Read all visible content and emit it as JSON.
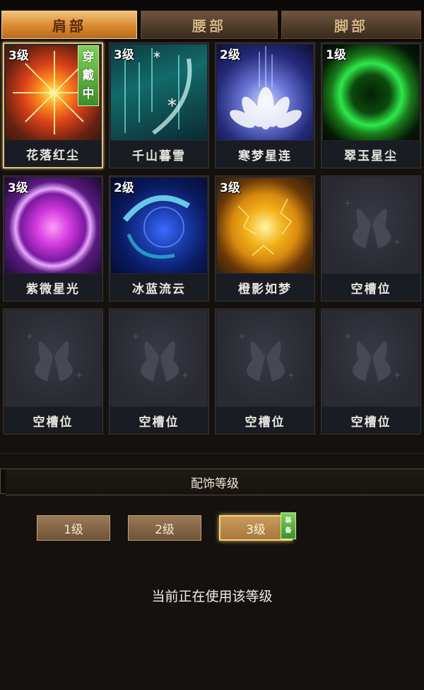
{
  "tabs": [
    {
      "label": "肩部",
      "active": true
    },
    {
      "label": "腰部",
      "active": false
    },
    {
      "label": "脚部",
      "active": false
    }
  ],
  "slots": [
    {
      "level": "3级",
      "name": "花落红尘",
      "icon": "red-sun-burst-icon",
      "color": "#e8701f",
      "worn": true,
      "selected": true
    },
    {
      "level": "3级",
      "name": "千山暮雪",
      "icon": "teal-snow-streaks-icon",
      "color": "#2aa8a0"
    },
    {
      "level": "2级",
      "name": "寒梦星连",
      "icon": "white-lotus-icon",
      "color": "#6a7ae8"
    },
    {
      "level": "1级",
      "name": "翠玉星尘",
      "icon": "green-orb-icon",
      "color": "#2ee84a"
    },
    {
      "level": "3级",
      "name": "紫微星光",
      "icon": "purple-orb-icon",
      "color": "#d23ae0"
    },
    {
      "level": "2级",
      "name": "冰蓝流云",
      "icon": "blue-swirl-icon",
      "color": "#2a72e8"
    },
    {
      "level": "3级",
      "name": "橙影如梦",
      "icon": "golden-orb-icon",
      "color": "#f2b018"
    },
    {
      "name": "空槽位",
      "empty": true
    },
    {
      "name": "空槽位",
      "empty": true
    },
    {
      "name": "空槽位",
      "empty": true
    },
    {
      "name": "空槽位",
      "empty": true
    },
    {
      "name": "空槽位",
      "empty": true
    }
  ],
  "worn_badge": [
    "穿",
    "戴",
    "中"
  ],
  "section_title": "配饰等级",
  "level_buttons": [
    {
      "label": "1级"
    },
    {
      "label": "2级"
    },
    {
      "label": "3级",
      "active": true,
      "badge": [
        "装",
        "备"
      ]
    }
  ],
  "status_text": "当前正在使用该等级"
}
